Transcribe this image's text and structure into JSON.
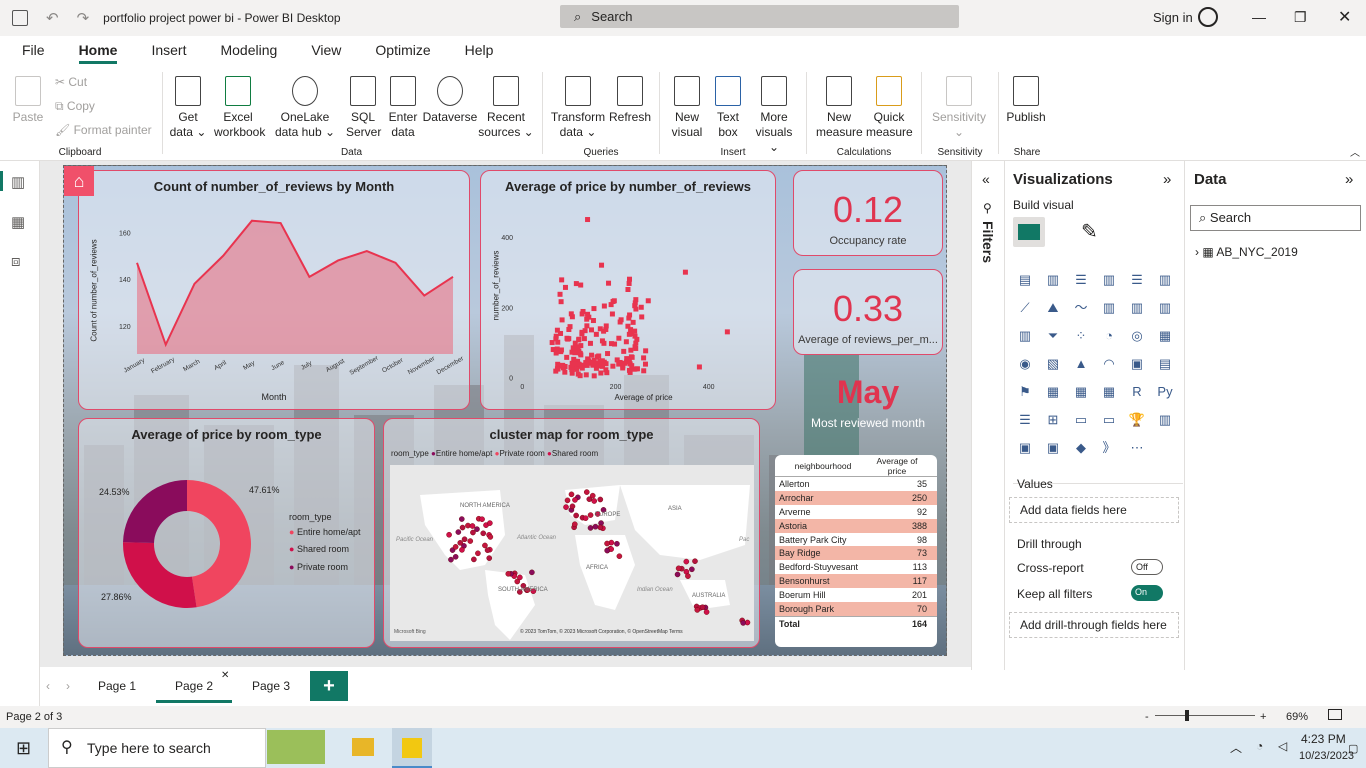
{
  "window": {
    "title": "portfolio project power bi - Power BI Desktop",
    "search_placeholder": "Search",
    "signin": "Sign in"
  },
  "menu": [
    "File",
    "Home",
    "Insert",
    "Modeling",
    "View",
    "Optimize",
    "Help"
  ],
  "ribbon": {
    "clipboard": {
      "paste": "Paste",
      "cut": "Cut",
      "copy": "Copy",
      "format_painter": "Format painter",
      "group": "Clipboard"
    },
    "data": {
      "get_data": "Get data ⌄",
      "excel": "Excel workbook",
      "onelake": "OneLake data hub ⌄",
      "sql": "SQL Server",
      "enter": "Enter data",
      "dataverse": "Dataverse",
      "recent": "Recent sources ⌄",
      "group": "Data"
    },
    "queries": {
      "transform": "Transform data ⌄",
      "refresh": "Refresh",
      "group": "Queries"
    },
    "insert": {
      "new_visual": "New visual",
      "text_box": "Text box",
      "more_visuals": "More visuals ⌄",
      "group": "Insert"
    },
    "calculations": {
      "new_measure": "New measure",
      "quick_measure": "Quick measure",
      "group": "Calculations"
    },
    "sensitivity": {
      "label": "Sensitivity ⌄",
      "group": "Sensitivity"
    },
    "share": {
      "publish": "Publish",
      "group": "Share"
    }
  },
  "report": {
    "area_chart": {
      "title": "Count of number_of_reviews by Month",
      "xlabel": "Month",
      "ylabel": "Count of number_of_reviews"
    },
    "scatter_chart": {
      "title": "Average of price by number_of_reviews",
      "xlabel": "Average of price",
      "ylabel": "number_of_reviews"
    },
    "kpi1": {
      "value": "0.12",
      "label": "Occupancy rate"
    },
    "kpi2": {
      "value": "0.33",
      "label": "Average of reviews_per_m..."
    },
    "kpi3": {
      "value": "May",
      "label": "Most reviewed month"
    },
    "donut": {
      "title": "Average of price by room_type",
      "legend_title": "room_type",
      "labels": [
        "47.61%",
        "27.86%",
        "24.53%"
      ],
      "legend": [
        "Entire home/apt",
        "Shared room",
        "Private room"
      ]
    },
    "map": {
      "title": "cluster map for room_type",
      "legend_title": "room_type",
      "legend": [
        "Entire home/apt",
        "Private room",
        "Shared room"
      ],
      "regions": [
        "NORTH AMERICA",
        "SOUTH AMERICA",
        "EUROPE",
        "AFRICA",
        "ASIA",
        "AUSTRALIA",
        "Atlantic Ocean",
        "Indian Ocean",
        "Pacific Ocean",
        "Pac"
      ],
      "attribution": "© 2023 TomTom, © 2023 Microsoft Corporation, © OpenStreetMap Terms",
      "brand": "Microsoft Bing"
    },
    "table": {
      "headers": [
        "neighbourhood",
        "Average of price"
      ],
      "rows": [
        [
          "Allerton",
          "35"
        ],
        [
          "Arrochar",
          "250"
        ],
        [
          "Arverne",
          "92"
        ],
        [
          "Astoria",
          "388"
        ],
        [
          "Battery Park City",
          "98"
        ],
        [
          "Bay Ridge",
          "73"
        ],
        [
          "Bedford-Stuyvesant",
          "113"
        ],
        [
          "Bensonhurst",
          "117"
        ],
        [
          "Boerum Hill",
          "201"
        ],
        [
          "Borough Park",
          "70"
        ]
      ],
      "total": [
        "Total",
        "164"
      ]
    }
  },
  "chart_data": [
    {
      "type": "area",
      "title": "Count of number_of_reviews by Month",
      "xlabel": "Month",
      "ylabel": "Count of number_of_reviews",
      "categories": [
        "January",
        "February",
        "March",
        "April",
        "May",
        "June",
        "July",
        "August",
        "September",
        "October",
        "November",
        "December"
      ],
      "values": [
        147,
        112,
        138,
        150,
        165,
        164,
        141,
        148,
        152,
        147,
        133,
        141
      ],
      "yticks": [
        "120",
        "140",
        "160"
      ],
      "ylim": [
        108,
        170
      ]
    },
    {
      "type": "scatter",
      "title": "Average of price by number_of_reviews",
      "xlabel": "Average of price",
      "ylabel": "number_of_reviews",
      "xticks": [
        "0",
        "200",
        "400"
      ],
      "yticks": [
        "0",
        "200",
        "400"
      ],
      "xlim": [
        -20,
        480
      ],
      "ylim": [
        -10,
        480
      ]
    },
    {
      "type": "pie",
      "title": "Average of price by room_type",
      "categories": [
        "Entire home/apt",
        "Shared room",
        "Private room"
      ],
      "values": [
        47.61,
        27.86,
        24.53
      ],
      "colors": [
        "#f0455f",
        "#d0104a",
        "#8a0c5c"
      ]
    }
  ],
  "filters": {
    "label": "Filters"
  },
  "visualizations": {
    "title": "Visualizations",
    "build_visual": "Build visual",
    "values": "Values",
    "add_fields": "Add data fields here",
    "drill_through": "Drill through",
    "cross_report": "Cross-report",
    "cross_state": "Off",
    "keep_filters": "Keep all filters",
    "keep_state": "On",
    "add_drill": "Add drill-through fields here"
  },
  "data_pane": {
    "title": "Data",
    "search": "Search",
    "table": "AB_NYC_2019"
  },
  "pages": [
    "Page 1",
    "Page 2",
    "Page 3"
  ],
  "status": {
    "page": "Page 2 of 3",
    "zoom": "69%"
  },
  "taskbar": {
    "search": "Type here to search",
    "time": "4:23 PM",
    "date": "10/23/2023"
  }
}
